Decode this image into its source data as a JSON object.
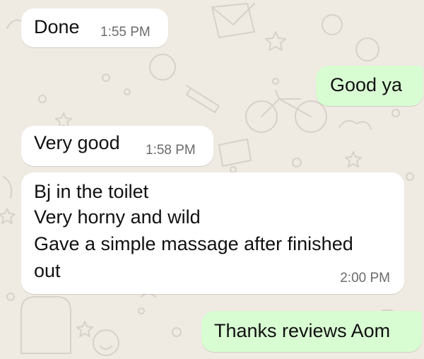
{
  "chat": {
    "wallpaper_color": "#efeae2",
    "incoming_bubble_color": "#ffffff",
    "outgoing_bubble_color": "#d9fdd3",
    "messages": [
      {
        "direction": "incoming",
        "text": "Done",
        "time": "1:55 PM"
      },
      {
        "direction": "outgoing",
        "text": "Good ya"
      },
      {
        "direction": "incoming",
        "text": "Very good",
        "time": "1:58 PM"
      },
      {
        "direction": "incoming",
        "lines": [
          "Bj in the toilet",
          "Very horny and wild",
          "Gave a simple massage after finished",
          "out"
        ],
        "time": "2:00 PM"
      },
      {
        "direction": "outgoing",
        "text": "Thanks reviews Aom"
      }
    ]
  }
}
